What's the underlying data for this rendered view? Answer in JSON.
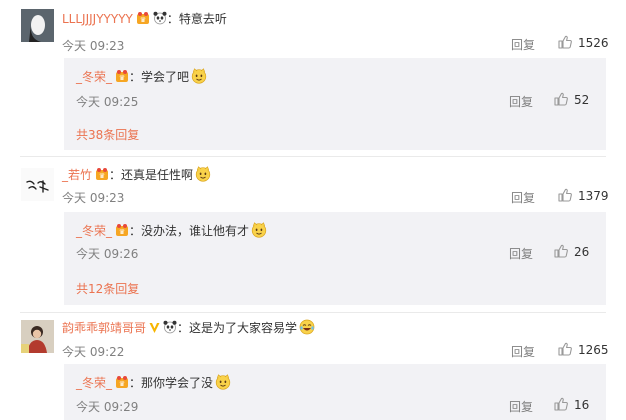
{
  "colors": {
    "name": "#eb7350",
    "meta": "#808080",
    "reply_bg": "#f2f2f5"
  },
  "comments": [
    {
      "user": "LLLJJJJYYYYY",
      "text": "：特意去听",
      "time": "今天 09:23",
      "reply_label": "回复",
      "likes": "1526",
      "sub": {
        "user": "_冬荣_",
        "text": "：学会了吧",
        "time": "今天 09:25",
        "reply_label": "回复",
        "likes": "52",
        "more": "共38条回复"
      }
    },
    {
      "user": "_若竹",
      "text": "：还真是任性啊",
      "time": "今天 09:23",
      "reply_label": "回复",
      "likes": "1379",
      "sub": {
        "user": "_冬荣_",
        "text": "：没办法，谁让他有才",
        "time": "今天 09:26",
        "reply_label": "回复",
        "likes": "26",
        "more": "共12条回复"
      }
    },
    {
      "user": "韵乖乖郭靖哥哥",
      "text": "：这是为了大家容易学",
      "time": "今天 09:22",
      "reply_label": "回复",
      "likes": "1265",
      "sub": {
        "user": "_冬荣_",
        "text": "：那你学会了没",
        "time": "今天 09:29",
        "reply_label": "回复",
        "likes": "16"
      }
    }
  ]
}
